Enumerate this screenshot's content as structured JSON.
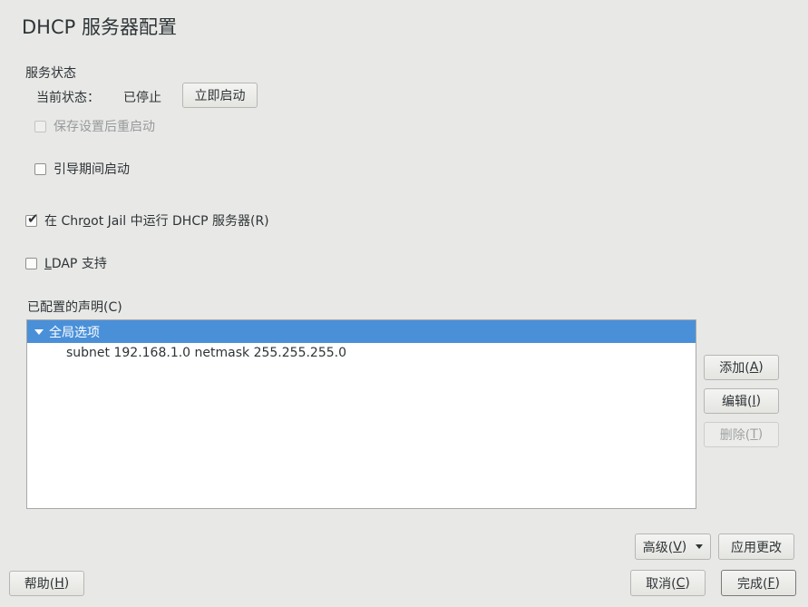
{
  "window": {
    "title": "DHCP 服务器配置"
  },
  "service": {
    "section_label": "服务状态",
    "status_label": "当前状态：",
    "status_value": "已停止",
    "start_button": "立即启动",
    "restart_after_save": {
      "label": "保存设置后重启动",
      "checked": false,
      "enabled": false
    },
    "start_on_boot": {
      "label": "引导期间启动",
      "checked": false,
      "enabled": true
    }
  },
  "chroot": {
    "label_pre": "在 Chr",
    "label_mn": "o",
    "label_post": "ot Jail 中运行 DHCP 服务器(R)",
    "checked": true
  },
  "ldap": {
    "label_mn": "L",
    "label_post": "DAP 支持",
    "checked": false
  },
  "declarations": {
    "label": "已配置的声明(C)",
    "tree": {
      "root_label": "全局选项",
      "children": [
        "subnet 192.168.1.0 netmask 255.255.255.0"
      ]
    },
    "add": {
      "pre": "添加(",
      "mn": "A",
      "post": ")"
    },
    "edit": {
      "pre": "编辑(",
      "mn": "I",
      "post": ")"
    },
    "delete": {
      "pre": "删除(",
      "mn": "T",
      "post": ")"
    }
  },
  "bottom": {
    "advanced": {
      "pre": "高级(",
      "mn": "V",
      "post": ")"
    },
    "apply": "应用更改",
    "help": {
      "pre": "帮助(",
      "mn": "H",
      "post": ")"
    },
    "cancel": {
      "pre": "取消(",
      "mn": "C",
      "post": ")"
    },
    "finish": {
      "pre": "完成(",
      "mn": "F",
      "post": ")"
    }
  },
  "colors": {
    "background": "#e8e8e7",
    "selection": "#4a90d9",
    "text": "#2e3436",
    "disabled_text": "#a0a3a3"
  },
  "icons": {
    "checkmark": "check-icon",
    "expander": "triangle-down-icon",
    "dropdown": "dropdown-arrow-icon"
  }
}
